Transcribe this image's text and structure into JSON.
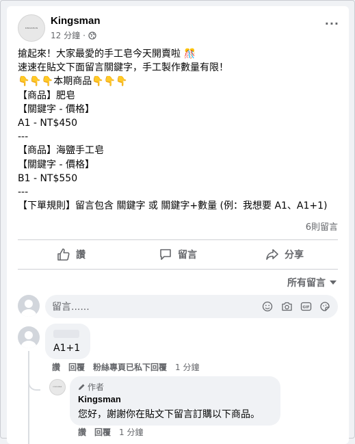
{
  "post": {
    "page_name": "Kingsman",
    "avatar_text": "KINGSMAN",
    "time": "12 分鐘",
    "privacy_icon": "globe-icon",
    "lines": [
      "搶起來！大家最愛的手工皂今天開賣啦 🎊",
      "速速在貼文下面留言關鍵字，手工製作數量有限！",
      "👇👇👇本期商品👇👇👇",
      "【商品】肥皂",
      "【關鍵字 - 價格】",
      "A1 - NT$450",
      "---",
      "【商品】海鹽手工皂",
      "【關鍵字 - 價格】",
      "B1 - NT$550",
      "---",
      "【下單規則】留言包含 關鍵字 或 關鍵字+數量 (例：我想要 A1、A1+1)"
    ],
    "comment_count": "6則留言"
  },
  "actions": {
    "like": "讚",
    "comment": "留言",
    "share": "分享"
  },
  "sort_label": "所有留言",
  "comment_input": {
    "placeholder": "留言......"
  },
  "comments": [
    {
      "text": "A1+1",
      "actions": [
        "讚",
        "回覆",
        "粉絲專頁已私下回覆",
        "1 分鐘"
      ]
    }
  ],
  "reply": {
    "author_badge": "作者",
    "name": "Kingsman",
    "avatar_text": "KINGSMAN",
    "text": "您好，謝謝你在貼文下留言訂購以下商品。",
    "actions": [
      "讚",
      "回覆",
      "1 分鐘"
    ]
  },
  "colors": {
    "secondary_text": "#65676b",
    "bubble": "#f0f2f5",
    "divider": "#ced0d4"
  }
}
